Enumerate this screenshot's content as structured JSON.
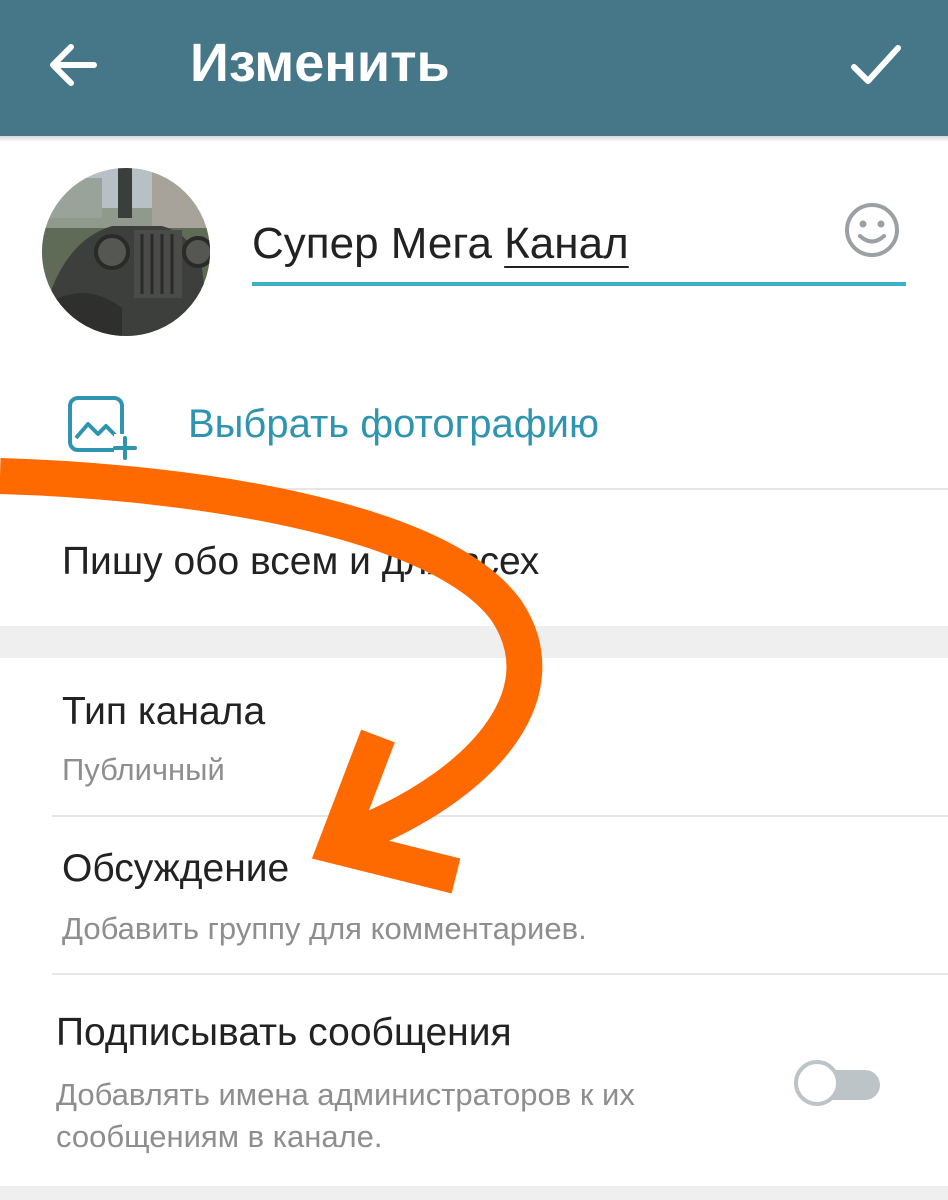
{
  "header": {
    "title": "Изменить",
    "back_icon": "arrow-left-icon",
    "confirm_icon": "checkmark-icon",
    "background_color": "#457789"
  },
  "channel": {
    "name_part1": "Супер Мега ",
    "name_part2": "Канал",
    "emoji_icon": "smiley-icon",
    "accent_color": "#3bb0c9"
  },
  "photo": {
    "label": "Выбрать фотографию",
    "icon": "add-photo-icon",
    "color": "#2e94b0"
  },
  "description": {
    "text": "Пишу обо всем и для всех"
  },
  "settings": {
    "channel_type": {
      "title": "Тип канала",
      "value": "Публичный"
    },
    "discussion": {
      "title": "Обсуждение",
      "subtitle": "Добавить группу для комментариев."
    },
    "sign_messages": {
      "title": "Подписывать сообщения",
      "subtitle_line1": "Добавлять имена администраторов к их",
      "subtitle_line2": "сообщениям в канале.",
      "enabled": false
    }
  },
  "annotation": {
    "arrow_color": "#ff6a00"
  }
}
